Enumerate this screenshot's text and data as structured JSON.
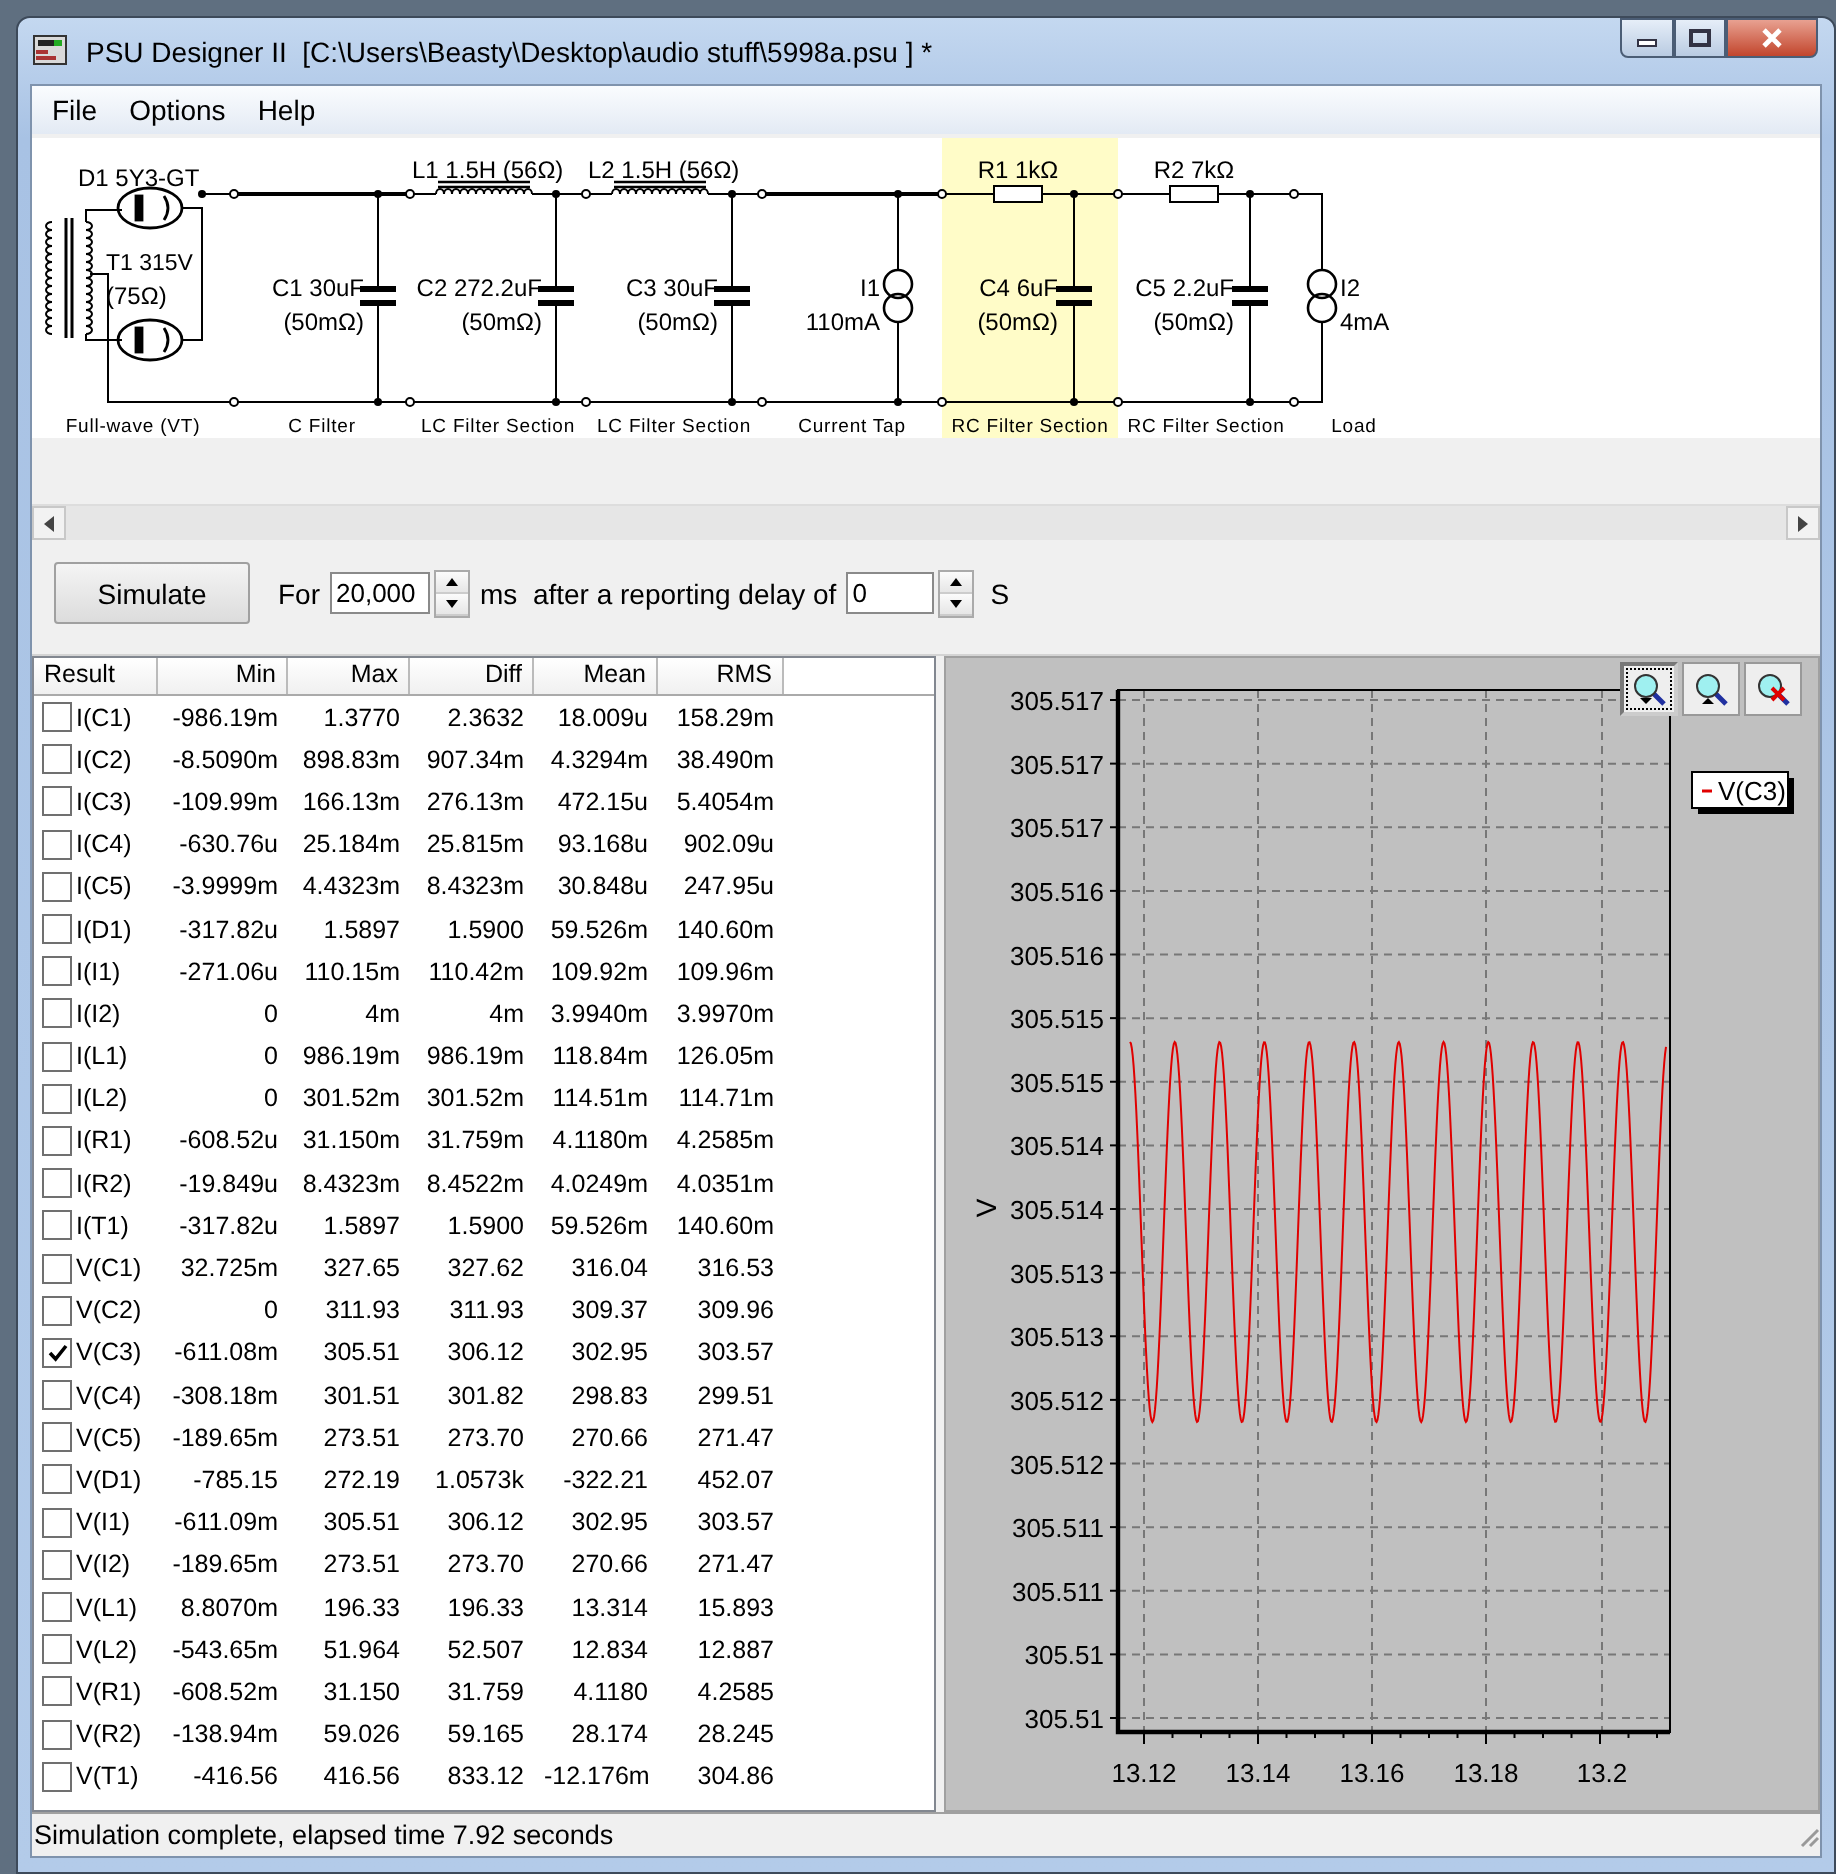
{
  "window": {
    "title": "PSU Designer II  [C:\\Users\\Beasty\\Desktop\\audio stuff\\5998a.psu ] *"
  },
  "menu": [
    "File",
    "Options",
    "Help"
  ],
  "schematic": {
    "sections": [
      {
        "kind": "fullwave",
        "label": "Full-wave (VT)",
        "selected": false,
        "components": [
          "D1 5Y3-GT",
          "T1 315V",
          "(75Ω)"
        ]
      },
      {
        "kind": "cfilter",
        "label": "C Filter",
        "selected": false,
        "components": [
          "C1 30uF",
          "(50mΩ)"
        ]
      },
      {
        "kind": "lc",
        "label": "LC Filter Section",
        "selected": false,
        "components": [
          "L1 1.5H (56Ω)",
          "C2 272.2uF",
          "(50mΩ)"
        ]
      },
      {
        "kind": "lc",
        "label": "LC Filter Section",
        "selected": false,
        "components": [
          "L2 1.5H (56Ω)",
          "C3 30uF",
          "(50mΩ)"
        ]
      },
      {
        "kind": "current",
        "label": "Current Tap",
        "selected": false,
        "components": [
          "I1",
          "110mA"
        ]
      },
      {
        "kind": "rc",
        "label": "RC Filter Section",
        "selected": true,
        "components": [
          "R1 1kΩ",
          "C4 6uF",
          "(50mΩ)"
        ]
      },
      {
        "kind": "rc",
        "label": "RC Filter Section",
        "selected": false,
        "components": [
          "R2 7kΩ",
          "C5 2.2uF",
          "(50mΩ)"
        ]
      },
      {
        "kind": "load",
        "label": "Load",
        "selected": false,
        "components": [
          "I2",
          "4mA"
        ]
      }
    ]
  },
  "toolbar": {
    "button": "Simulate",
    "for_label": "For",
    "duration": "20,000",
    "duration_label": "ms  after a reporting delay of",
    "delay": "0",
    "delay_label": "S"
  },
  "table": {
    "columns": [
      "Result",
      "Min",
      "Max",
      "Diff",
      "Mean",
      "RMS"
    ],
    "rows": [
      {
        "checked": false,
        "cells": [
          "I(C1)",
          "-986.19m",
          "1.3770",
          "2.3632",
          "18.009u",
          "158.29m"
        ]
      },
      {
        "checked": false,
        "cells": [
          "I(C2)",
          "-8.5090m",
          "898.83m",
          "907.34m",
          "4.3294m",
          "38.490m"
        ]
      },
      {
        "checked": false,
        "cells": [
          "I(C3)",
          "-109.99m",
          "166.13m",
          "276.13m",
          "472.15u",
          "5.4054m"
        ]
      },
      {
        "checked": false,
        "cells": [
          "I(C4)",
          "-630.76u",
          "25.184m",
          "25.815m",
          "93.168u",
          "902.09u"
        ]
      },
      {
        "checked": false,
        "cells": [
          "I(C5)",
          "-3.9999m",
          "4.4323m",
          "8.4323m",
          "30.848u",
          "247.95u"
        ]
      },
      {
        "checked": false,
        "cells": [
          "I(D1)",
          "-317.82u",
          "1.5897",
          "1.5900",
          "59.526m",
          "140.60m"
        ]
      },
      {
        "checked": false,
        "cells": [
          "I(I1)",
          "-271.06u",
          "110.15m",
          "110.42m",
          "109.92m",
          "109.96m"
        ]
      },
      {
        "checked": false,
        "cells": [
          "I(I2)",
          "0",
          "4m",
          "4m",
          "3.9940m",
          "3.9970m"
        ]
      },
      {
        "checked": false,
        "cells": [
          "I(L1)",
          "0",
          "986.19m",
          "986.19m",
          "118.84m",
          "126.05m"
        ]
      },
      {
        "checked": false,
        "cells": [
          "I(L2)",
          "0",
          "301.52m",
          "301.52m",
          "114.51m",
          "114.71m"
        ]
      },
      {
        "checked": false,
        "cells": [
          "I(R1)",
          "-608.52u",
          "31.150m",
          "31.759m",
          "4.1180m",
          "4.2585m"
        ]
      },
      {
        "checked": false,
        "cells": [
          "I(R2)",
          "-19.849u",
          "8.4323m",
          "8.4522m",
          "4.0249m",
          "4.0351m"
        ]
      },
      {
        "checked": false,
        "cells": [
          "I(T1)",
          "-317.82u",
          "1.5897",
          "1.5900",
          "59.526m",
          "140.60m"
        ]
      },
      {
        "checked": false,
        "cells": [
          "V(C1)",
          "32.725m",
          "327.65",
          "327.62",
          "316.04",
          "316.53"
        ]
      },
      {
        "checked": false,
        "cells": [
          "V(C2)",
          "0",
          "311.93",
          "311.93",
          "309.37",
          "309.96"
        ]
      },
      {
        "checked": true,
        "cells": [
          "V(C3)",
          "-611.08m",
          "305.51",
          "306.12",
          "302.95",
          "303.57"
        ]
      },
      {
        "checked": false,
        "cells": [
          "V(C4)",
          "-308.18m",
          "301.51",
          "301.82",
          "298.83",
          "299.51"
        ]
      },
      {
        "checked": false,
        "cells": [
          "V(C5)",
          "-189.65m",
          "273.51",
          "273.70",
          "270.66",
          "271.47"
        ]
      },
      {
        "checked": false,
        "cells": [
          "V(D1)",
          "-785.15",
          "272.19",
          "1.0573k",
          "-322.21",
          "452.07"
        ]
      },
      {
        "checked": false,
        "cells": [
          "V(I1)",
          "-611.09m",
          "305.51",
          "306.12",
          "302.95",
          "303.57"
        ]
      },
      {
        "checked": false,
        "cells": [
          "V(I2)",
          "-189.65m",
          "273.51",
          "273.70",
          "270.66",
          "271.47"
        ]
      },
      {
        "checked": false,
        "cells": [
          "V(L1)",
          "8.8070m",
          "196.33",
          "196.33",
          "13.314",
          "15.893"
        ]
      },
      {
        "checked": false,
        "cells": [
          "V(L2)",
          "-543.65m",
          "51.964",
          "52.507",
          "12.834",
          "12.887"
        ]
      },
      {
        "checked": false,
        "cells": [
          "V(R1)",
          "-608.52m",
          "31.150",
          "31.759",
          "4.1180",
          "4.2585"
        ]
      },
      {
        "checked": false,
        "cells": [
          "V(R2)",
          "-138.94m",
          "59.026",
          "59.165",
          "28.174",
          "28.245"
        ]
      },
      {
        "checked": false,
        "cells": [
          "V(T1)",
          "-416.56",
          "416.56",
          "833.12",
          "-12.176m",
          "304.86"
        ]
      }
    ]
  },
  "chart": {
    "legend": "V(C3)",
    "ylabel": "V",
    "ytick_labels": [
      "305.517",
      "305.517",
      "305.517",
      "305.516",
      "305.516",
      "305.515",
      "305.515",
      "305.514",
      "305.514",
      "305.513",
      "305.513",
      "305.512",
      "305.512",
      "305.511",
      "305.511",
      "305.51",
      "305.51"
    ],
    "xtick_labels": [
      "13.12",
      "13.14",
      "13.16",
      "13.18",
      "13.2"
    ]
  },
  "status_bar": "Simulation complete, elapsed time 7.92 seconds"
}
